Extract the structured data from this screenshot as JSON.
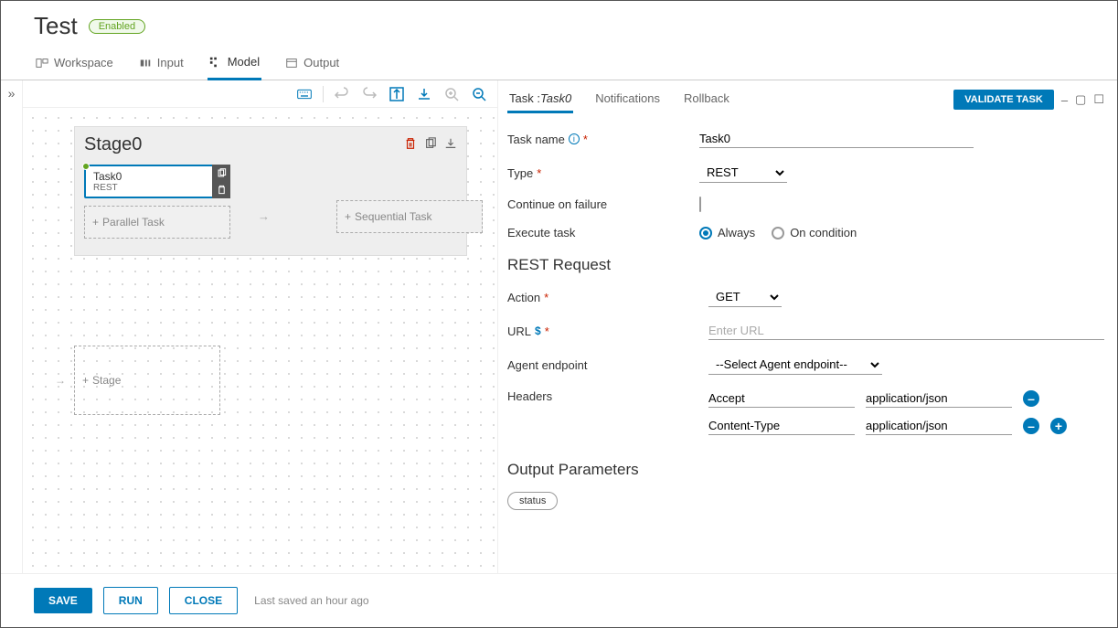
{
  "header": {
    "title": "Test",
    "badge": "Enabled"
  },
  "tabs": [
    "Workspace",
    "Input",
    "Model",
    "Output"
  ],
  "canvas": {
    "stage_title": "Stage0",
    "task": {
      "name": "Task0",
      "type": "REST"
    },
    "parallel_placeholder": "Parallel Task",
    "sequential_placeholder": "Sequential Task",
    "add_stage": "Stage"
  },
  "right": {
    "tabs": {
      "task_prefix": "Task :",
      "task_name_italic": "Task0",
      "notifications": "Notifications",
      "rollback": "Rollback"
    },
    "validate_btn": "VALIDATE TASK",
    "labels": {
      "task_name": "Task name",
      "type": "Type",
      "continue": "Continue on failure",
      "execute": "Execute task",
      "always": "Always",
      "on_condition": "On condition"
    },
    "values": {
      "task_name": "Task0",
      "type": "REST"
    },
    "rest_section": "REST Request",
    "rest": {
      "action_label": "Action",
      "action_value": "GET",
      "url_label": "URL",
      "url_placeholder": "Enter URL",
      "agent_label": "Agent endpoint",
      "agent_value": "--Select Agent endpoint--",
      "headers_label": "Headers",
      "headers": [
        {
          "key": "Accept",
          "value": "application/json"
        },
        {
          "key": "Content-Type",
          "value": "application/json"
        }
      ]
    },
    "output_section": "Output Parameters",
    "output_chip": "status"
  },
  "footer": {
    "save": "SAVE",
    "run": "RUN",
    "close": "CLOSE",
    "status": "Last saved an hour ago"
  }
}
